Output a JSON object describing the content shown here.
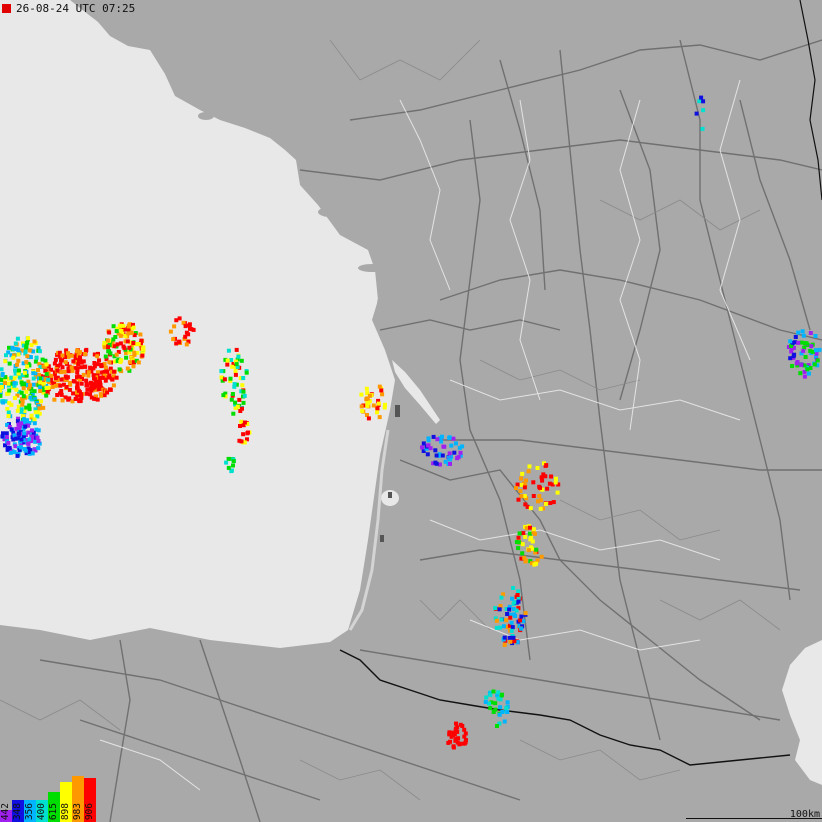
{
  "timestamp": "26-08-24 UTC 07:25",
  "scale_label": "100km",
  "colors": {
    "sea": "#e8e8e8",
    "land": "#a9a9a9",
    "road": "#6e6e6e",
    "border": "#ffffff",
    "national_border": "#111111"
  },
  "legend": [
    {
      "label": "442",
      "color": "#a020f0"
    },
    {
      "label": "348",
      "color": "#1010e0"
    },
    {
      "label": "356",
      "color": "#00b4ff"
    },
    {
      "label": "400",
      "color": "#00e0d0"
    },
    {
      "label": "615",
      "color": "#00dd00"
    },
    {
      "label": "898",
      "color": "#ffff00"
    },
    {
      "label": "983",
      "color": "#ff9900"
    },
    {
      "label": "906",
      "color": "#ff0000"
    }
  ]
}
